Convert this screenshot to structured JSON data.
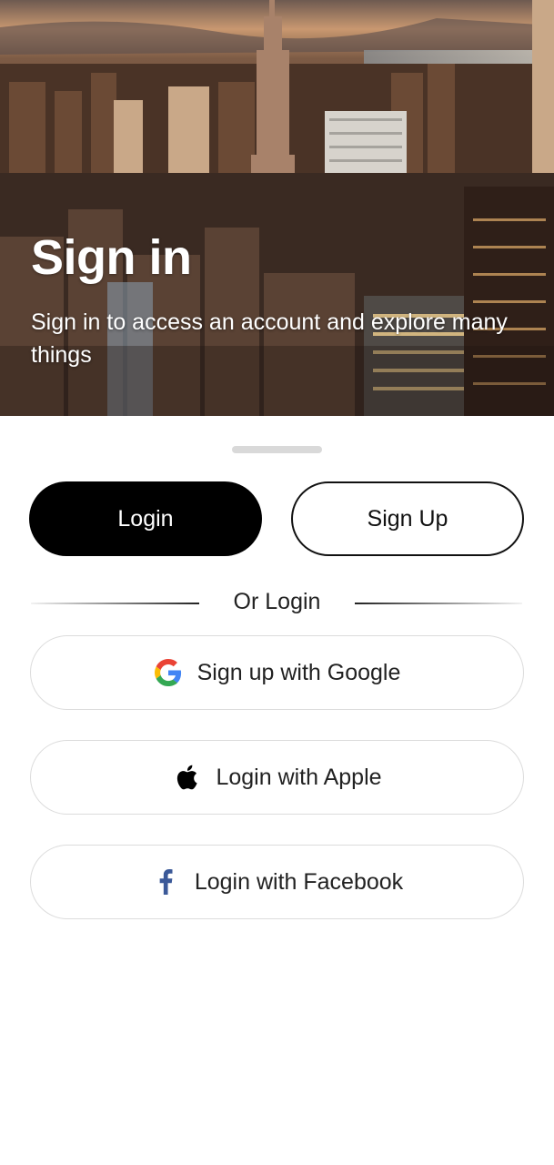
{
  "hero": {
    "title": "Sign in",
    "subtitle": "Sign in to access an account and explore many things"
  },
  "tabs": {
    "login_label": "Login",
    "signup_label": "Sign Up"
  },
  "divider": {
    "text": "Or Login"
  },
  "social": [
    {
      "label": "Sign up with Google",
      "icon": "google-icon"
    },
    {
      "label": "Login with Apple",
      "icon": "apple-icon"
    },
    {
      "label": "Login with Facebook",
      "icon": "facebook-icon"
    }
  ],
  "colors": {
    "primary": "#000000",
    "background": "#ffffff",
    "facebook_blue": "#3b5998"
  }
}
